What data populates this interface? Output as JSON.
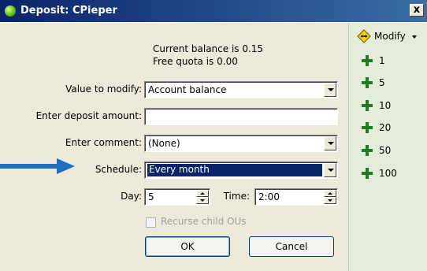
{
  "window": {
    "title": "Deposit: CPieper",
    "close_label": "x"
  },
  "info": {
    "current_balance": "Current balance is 0.15",
    "free_quota": "Free quota is 0.00"
  },
  "form": {
    "value_to_modify_label": "Value to modify:",
    "value_to_modify_value": "Account balance",
    "deposit_amount_label": "Enter deposit amount:",
    "deposit_amount_value": "",
    "comment_label": "Enter comment:",
    "comment_value": "(None)",
    "schedule_label": "Schedule:",
    "schedule_value": "Every month",
    "day_label": "Day:",
    "day_value": "5",
    "time_label": "Time:",
    "time_value": "2:00",
    "recurse_label": "Recurse child OUs",
    "recurse_checked": false
  },
  "buttons": {
    "ok": "OK",
    "cancel": "Cancel"
  },
  "side": {
    "modify_label": "Modify",
    "amounts": [
      "1",
      "5",
      "10",
      "20",
      "50",
      "100"
    ]
  },
  "colors": {
    "titlebar_start": "#0a246a",
    "titlebar_end": "#3a6ea5",
    "arrow": "#1f6fbf",
    "plus": "#1e7d1e",
    "side_panel": "#e2ecd8"
  }
}
